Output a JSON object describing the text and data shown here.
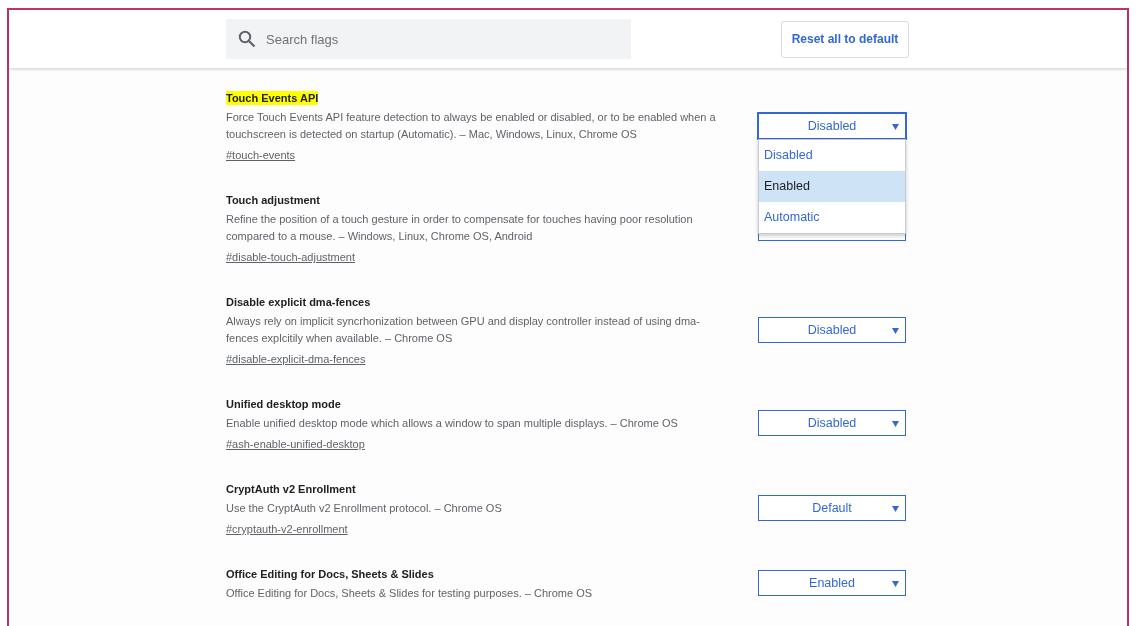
{
  "search": {
    "placeholder": "Search flags"
  },
  "reset_button": "Reset all to default",
  "flags": [
    {
      "title": "Touch Events API",
      "highlighted": true,
      "description": "Force Touch Events API feature detection to always be enabled or disabled, or to be enabled when a touchscreen is detected on startup (Automatic). – Mac, Windows, Linux, Chrome OS",
      "link": "#touch-events",
      "value": "Disabled",
      "expanded": true,
      "options": [
        {
          "label": "Disabled",
          "highlighted": false
        },
        {
          "label": "Enabled",
          "highlighted": true
        },
        {
          "label": "Automatic",
          "highlighted": false
        }
      ]
    },
    {
      "title": "Touch adjustment",
      "highlighted": false,
      "description": "Refine the position of a touch gesture in order to compensate for touches having poor resolution compared to a mouse. – Windows, Linux, Chrome OS, Android",
      "link": "#disable-touch-adjustment",
      "expanded": false
    },
    {
      "title": "Disable explicit dma-fences",
      "highlighted": false,
      "description": "Always rely on implicit syncrhonization between GPU and display controller instead of using dma-fences explcitily when available. – Chrome OS",
      "link": "#disable-explicit-dma-fences",
      "value": "Disabled",
      "expanded": false
    },
    {
      "title": "Unified desktop mode",
      "highlighted": false,
      "description": "Enable unified desktop mode which allows a window to span multiple displays. – Chrome OS",
      "link": "#ash-enable-unified-desktop",
      "value": "Disabled",
      "expanded": false
    },
    {
      "title": "CryptAuth v2 Enrollment",
      "highlighted": false,
      "description": "Use the CryptAuth v2 Enrollment protocol. – Chrome OS",
      "link": "#cryptauth-v2-enrollment",
      "value": "Default",
      "expanded": false
    },
    {
      "title": "Office Editing for Docs, Sheets & Slides",
      "highlighted": false,
      "description": "Office Editing for Docs, Sheets & Slides for testing purposes. – Chrome OS",
      "value": "Enabled",
      "expanded": false
    }
  ]
}
